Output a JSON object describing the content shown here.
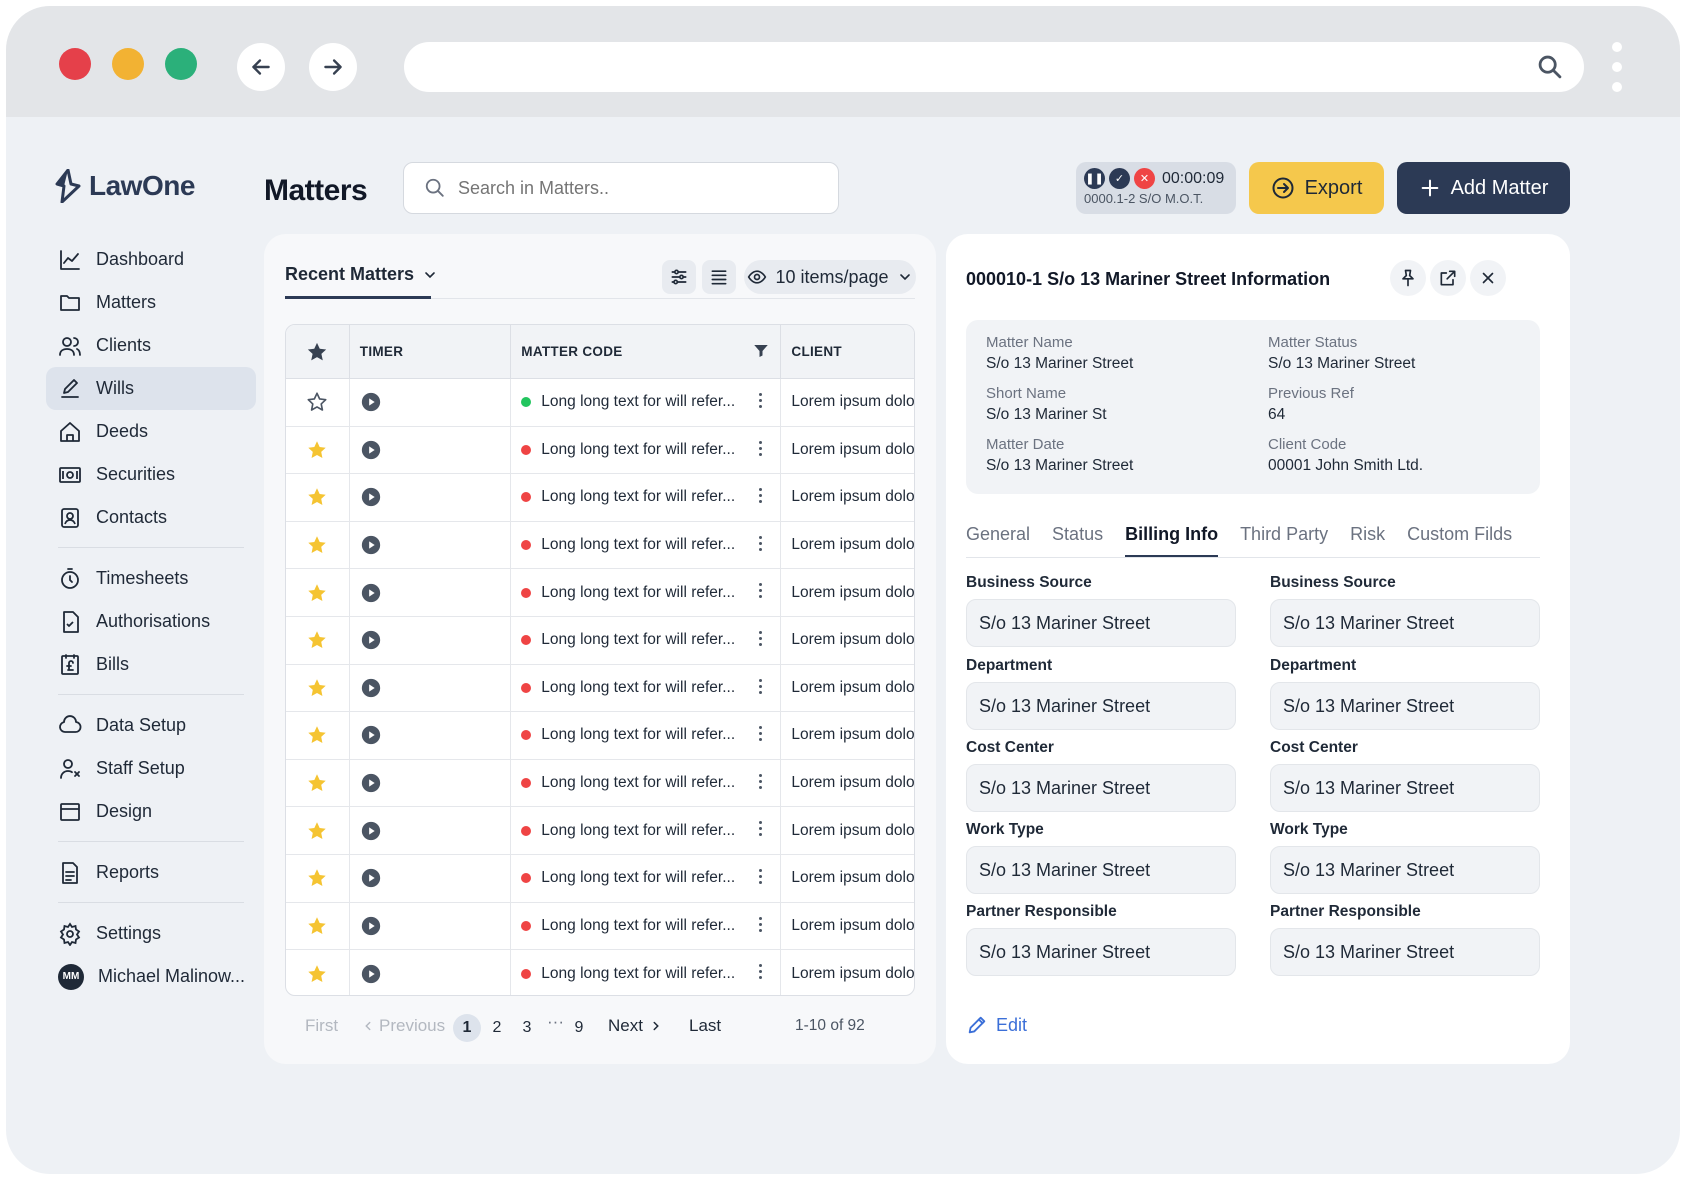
{
  "colors": {
    "dark_navy": "#2c3a55",
    "accent_yellow": "#f5c84c",
    "status_green": "#22c55e",
    "status_red": "#ef4444",
    "star_gold": "#f5c432",
    "link_blue": "#3b6fd8"
  },
  "app": {
    "name": "LawOne"
  },
  "sidebar": {
    "items": [
      {
        "label": "Dashboard",
        "icon": "chart-line-icon"
      },
      {
        "label": "Matters",
        "icon": "folder-icon"
      },
      {
        "label": "Clients",
        "icon": "users-icon"
      },
      {
        "label": "Wills",
        "icon": "pen-icon",
        "active": true
      },
      {
        "label": "Deeds",
        "icon": "home-icon"
      },
      {
        "label": "Securities",
        "icon": "cash-icon"
      },
      {
        "label": "Contacts",
        "icon": "contact-card-icon"
      },
      {
        "label": "Timesheets",
        "icon": "stopwatch-icon"
      },
      {
        "label": "Authorisations",
        "icon": "document-check-icon"
      },
      {
        "label": "Bills",
        "icon": "bill-icon"
      },
      {
        "label": "Data Setup",
        "icon": "cloud-icon"
      },
      {
        "label": "Staff Setup",
        "icon": "user-gear-icon"
      },
      {
        "label": "Design",
        "icon": "layout-icon"
      },
      {
        "label": "Reports",
        "icon": "report-icon"
      },
      {
        "label": "Settings",
        "icon": "gear-icon"
      }
    ],
    "user": {
      "initials": "MM",
      "name": "Michael Malinow..."
    }
  },
  "header": {
    "title": "Matters",
    "search_placeholder": "Search in Matters..",
    "timer": {
      "time": "00:00:09",
      "code": "0000.1-2 S/O M.O.T."
    },
    "export_label": "Export",
    "add_label": "Add Matter"
  },
  "list": {
    "tab_label": "Recent Matters",
    "per_page": "10 items/page",
    "columns": {
      "timer": "TIMER",
      "matter_code": "MATTER CODE",
      "client": "CLIENT"
    },
    "rows": [
      {
        "starred": false,
        "status": "green",
        "code": "Long long text for will refer...",
        "client": "Lorem ipsum dolo"
      },
      {
        "starred": true,
        "status": "red",
        "code": "Long long text for will refer...",
        "client": "Lorem ipsum dolo"
      },
      {
        "starred": true,
        "status": "red",
        "code": "Long long text for will refer...",
        "client": "Lorem ipsum dolo"
      },
      {
        "starred": true,
        "status": "red",
        "code": "Long long text for will refer...",
        "client": "Lorem ipsum dolo"
      },
      {
        "starred": true,
        "status": "red",
        "code": "Long long text for will refer...",
        "client": "Lorem ipsum dolo"
      },
      {
        "starred": true,
        "status": "red",
        "code": "Long long text for will refer...",
        "client": "Lorem ipsum dolo"
      },
      {
        "starred": true,
        "status": "red",
        "code": "Long long text for will refer...",
        "client": "Lorem ipsum dolo"
      },
      {
        "starred": true,
        "status": "red",
        "code": "Long long text for will refer...",
        "client": "Lorem ipsum dolo"
      },
      {
        "starred": true,
        "status": "red",
        "code": "Long long text for will refer...",
        "client": "Lorem ipsum dolo"
      },
      {
        "starred": true,
        "status": "red",
        "code": "Long long text for will refer...",
        "client": "Lorem ipsum dolo"
      },
      {
        "starred": true,
        "status": "red",
        "code": "Long long text for will refer...",
        "client": "Lorem ipsum dolo"
      },
      {
        "starred": true,
        "status": "red",
        "code": "Long long text for will refer...",
        "client": "Lorem ipsum dolo"
      },
      {
        "starred": true,
        "status": "red",
        "code": "Long long text for will refer...",
        "client": "Lorem ipsum dolo"
      }
    ],
    "pagination": {
      "first": "First",
      "previous": "Previous",
      "pages": [
        "1",
        "2",
        "3"
      ],
      "ellipsis": "···",
      "last_page": "9",
      "next": "Next",
      "last": "Last",
      "summary": "1-10 of 92",
      "current": "1"
    }
  },
  "detail": {
    "title": "000010-1 S/o 13 Mariner Street Information",
    "info": [
      {
        "label": "Matter Name",
        "value": "S/o 13 Mariner Street"
      },
      {
        "label": "Matter Status",
        "value": "S/o 13 Mariner Street"
      },
      {
        "label": "Short Name",
        "value": "S/o 13 Mariner St"
      },
      {
        "label": "Previous Ref",
        "value": "64"
      },
      {
        "label": "Matter Date",
        "value": "S/o 13 Mariner Street"
      },
      {
        "label": "Client Code",
        "value": "00001 John Smith  Ltd."
      }
    ],
    "tabs": [
      "General",
      "Status",
      "Billing Info",
      "Third Party",
      "Risk",
      "Custom Filds"
    ],
    "active_tab": "Billing Info",
    "fields": [
      {
        "label": "Business Source",
        "value": "S/o 13 Mariner Street"
      },
      {
        "label": "Business Source",
        "value": "S/o 13 Mariner Street"
      },
      {
        "label": "Department",
        "value": "S/o 13 Mariner Street"
      },
      {
        "label": "Department",
        "value": "S/o 13 Mariner Street"
      },
      {
        "label": "Cost Center",
        "value": "S/o 13 Mariner Street"
      },
      {
        "label": "Cost Center",
        "value": "S/o 13 Mariner Street"
      },
      {
        "label": "Work Type",
        "value": "S/o 13 Mariner Street"
      },
      {
        "label": "Work Type",
        "value": "S/o 13 Mariner Street"
      },
      {
        "label": "Partner Responsible",
        "value": "S/o 13 Mariner Street"
      },
      {
        "label": "Partner Responsible",
        "value": "S/o 13 Mariner Street"
      }
    ],
    "edit_label": "Edit"
  }
}
